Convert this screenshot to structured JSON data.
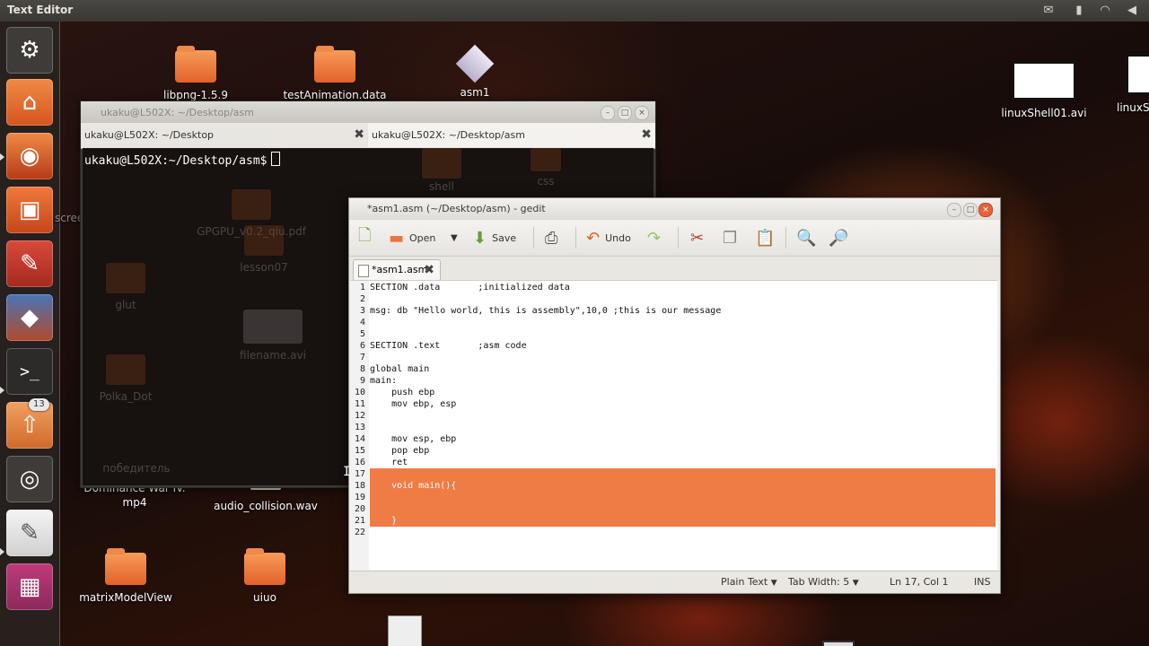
{
  "topbar": {
    "title": "Text Editor",
    "indicators": [
      "mail-icon",
      "battery-icon",
      "wifi-icon",
      "volume-icon"
    ]
  },
  "launcher": {
    "badge": "13"
  },
  "desktop": {
    "icons": [
      {
        "label": "libpng-1.5.9"
      },
      {
        "label": "testAnimation.data"
      },
      {
        "label": "asm1"
      },
      {
        "label": "linuxShell01.avi"
      },
      {
        "label": "linuxS"
      },
      {
        "label": "Dominance War IV.\nmp4"
      },
      {
        "label": "audio_collision.wav"
      },
      {
        "label": "matrixModelView"
      },
      {
        "label": "uiuo"
      },
      {
        "label": "screenCapture"
      }
    ],
    "ghost": {
      "g1": "GPGPU_v0.2_qiu.pdf",
      "g2": "lesson07",
      "g3": "glut",
      "g4": "filename.avi",
      "g5": "Polka_Dot",
      "g6": "победитель",
      "g7": "shell",
      "g8": "css"
    }
  },
  "terminal": {
    "title": "ukaku@L502X: ~/Desktop/asm",
    "tabs": [
      "ukaku@L502X: ~/Desktop",
      "ukaku@L502X: ~/Desktop/asm"
    ],
    "prompt": "ukaku@L502X:~/Desktop/asm$"
  },
  "gedit": {
    "title": "*asm1.asm (~/Desktop/asm) - gedit",
    "toolbar": {
      "open": "Open",
      "save": "Save",
      "undo": "Undo"
    },
    "tab": "*asm1.asm",
    "lines": [
      "SECTION .data       ;initialized data",
      "",
      "msg: db \"Hello world, this is assembly\",10,0 ;this is our message",
      "",
      "",
      "SECTION .text       ;asm code",
      "",
      "global main",
      "main:",
      "    push ebp",
      "    mov ebp, esp",
      "",
      "",
      "    mov esp, ebp",
      "    pop ebp",
      "    ret",
      "",
      "    void main(){",
      "",
      "",
      "    }",
      ""
    ],
    "line_numbers": [
      "1",
      "2",
      "3",
      "4",
      "5",
      "6",
      "7",
      "8",
      "9",
      "10",
      "11",
      "12",
      "13",
      "14",
      "15",
      "16",
      "17",
      "18",
      "19",
      "20",
      "21",
      "22"
    ],
    "status": {
      "language": "Plain Text",
      "tab_width": "Tab Width:  5",
      "position": "Ln 17, Col 1",
      "mode": "INS"
    }
  }
}
